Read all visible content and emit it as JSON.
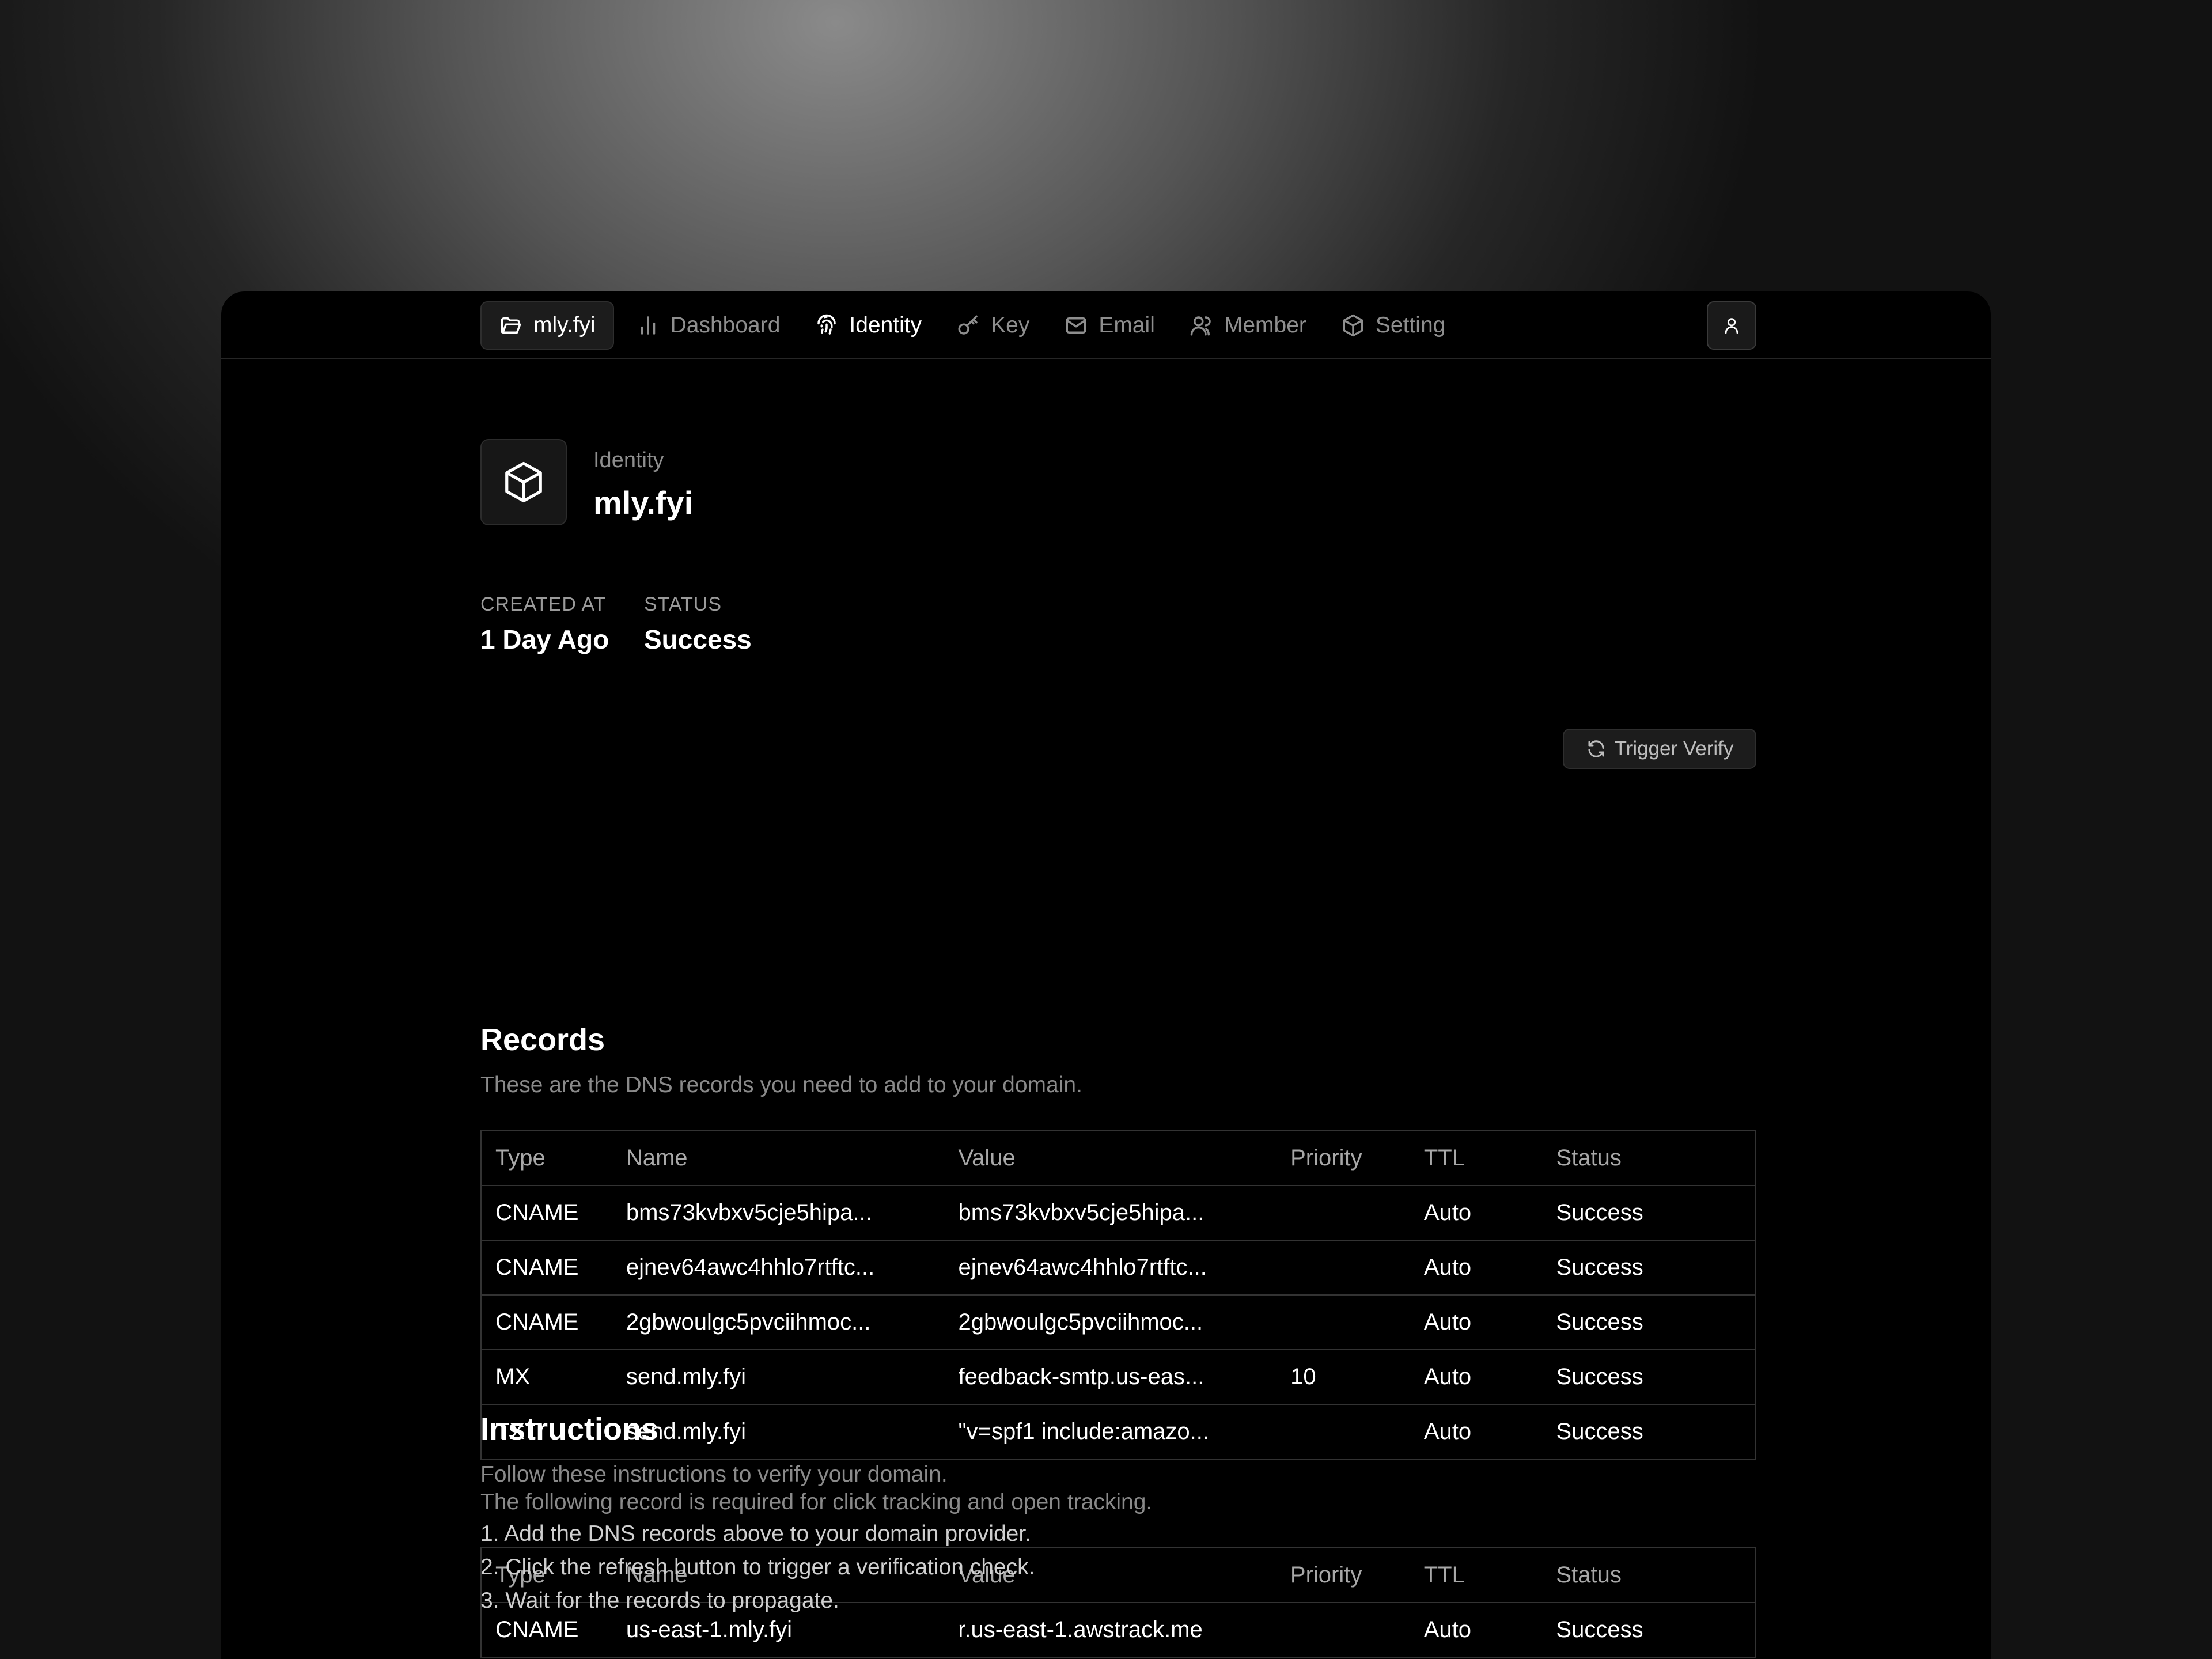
{
  "nav": {
    "project": "mly.fyi",
    "items": [
      {
        "label": "Dashboard",
        "icon": "bar-chart-icon"
      },
      {
        "label": "Identity",
        "icon": "fingerprint-icon",
        "active": true
      },
      {
        "label": "Key",
        "icon": "key-icon"
      },
      {
        "label": "Email",
        "icon": "mail-icon"
      },
      {
        "label": "Member",
        "icon": "users-icon"
      },
      {
        "label": "Setting",
        "icon": "cube-icon"
      }
    ]
  },
  "header": {
    "label": "Identity",
    "title": "mly.fyi"
  },
  "meta": {
    "created_label": "CREATED AT",
    "created_value": "1 Day Ago",
    "status_label": "STATUS",
    "status_value": "Success"
  },
  "records": {
    "title": "Records",
    "subtitle": "These are the DNS records you need to add to your domain.",
    "trigger_label": "Trigger Verify",
    "columns": [
      "Type",
      "Name",
      "Value",
      "Priority",
      "TTL",
      "Status"
    ],
    "rows": [
      [
        "CNAME",
        "bms73kvbxv5cje5hipa...",
        "bms73kvbxv5cje5hipa...",
        "",
        "Auto",
        "Success"
      ],
      [
        "CNAME",
        "ejnev64awc4hhlo7rtftc...",
        "ejnev64awc4hhlo7rtftc...",
        "",
        "Auto",
        "Success"
      ],
      [
        "CNAME",
        "2gbwoulgc5pvciihmoc...",
        "2gbwoulgc5pvciihmoc...",
        "",
        "Auto",
        "Success"
      ],
      [
        "MX",
        "send.mly.fyi",
        "feedback-smtp.us-eas...",
        "10",
        "Auto",
        "Success"
      ],
      [
        "TXT",
        "send.mly.fyi",
        "\"v=spf1 include:amazo...",
        "",
        "Auto",
        "Success"
      ]
    ]
  },
  "tracking": {
    "subtitle": "The following record is required for click tracking and open tracking.",
    "columns": [
      "Type",
      "Name",
      "Value",
      "Priority",
      "TTL",
      "Status"
    ],
    "rows": [
      [
        "CNAME",
        "us-east-1.mly.fyi",
        "r.us-east-1.awstrack.me",
        "",
        "Auto",
        "Success"
      ]
    ]
  },
  "instructions": {
    "title": "Instructions",
    "subtitle": "Follow these instructions to verify your domain.",
    "steps": [
      "1. Add the DNS records above to your domain provider.",
      "2. Click the refresh button to trigger a verification check.",
      "3. Wait for the records to propagate."
    ]
  }
}
